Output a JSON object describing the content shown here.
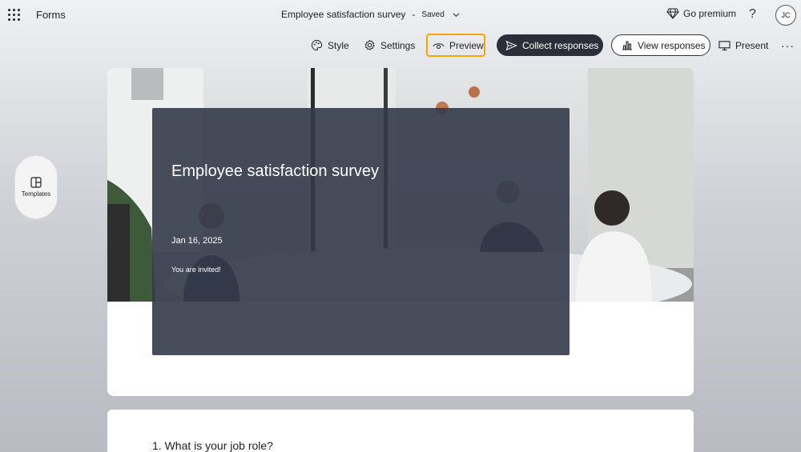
{
  "topbar": {
    "app_name": "Forms",
    "doc_title": "Employee satisfaction survey",
    "separator": "-",
    "saved_status": "Saved",
    "premium_label": "Go premium",
    "help_symbol": "?",
    "avatar_initials": "JC"
  },
  "toolbar": {
    "style_label": "Style",
    "settings_label": "Settings",
    "preview_label": "Preview",
    "collect_label": "Collect responses",
    "view_label": "View responses",
    "present_label": "Present",
    "more_label": "···"
  },
  "sidebar": {
    "templates_label": "Templates"
  },
  "form": {
    "title": "Employee satisfaction survey",
    "date": "Jan 16, 2025",
    "subtitle": "You are invited!"
  },
  "questions": [
    {
      "text": "1. What is your job role?"
    }
  ],
  "colors": {
    "accent_highlight": "#f2a600",
    "primary_button": "#2a2f3a",
    "overlay": "#343a4a"
  }
}
